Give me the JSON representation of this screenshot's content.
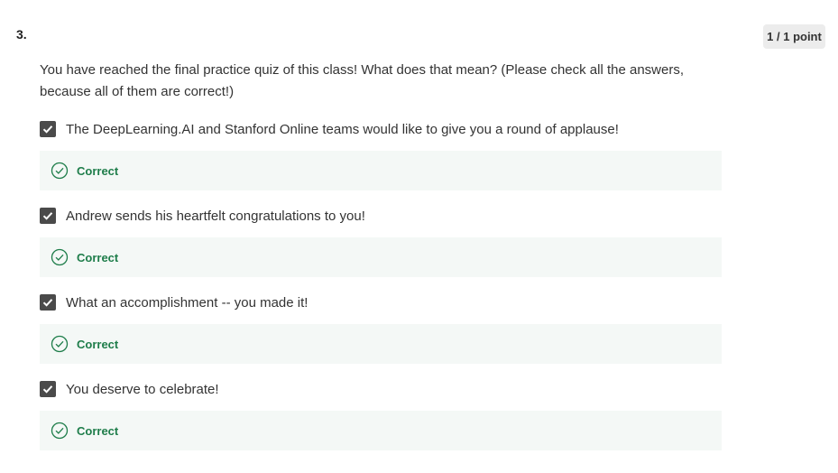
{
  "question": {
    "number": "3.",
    "score": "1 / 1 point",
    "prompt": "You have reached the final practice quiz of this class! What does that mean? (Please check all the answers, because all of them are correct!)",
    "options": [
      {
        "label": "The DeepLearning.AI and Stanford Online teams would like to give you a round of applause!",
        "checked": true,
        "feedback": "Correct"
      },
      {
        "label": "Andrew sends his heartfelt congratulations to you!",
        "checked": true,
        "feedback": "Correct"
      },
      {
        "label": "What an accomplishment -- you made it!",
        "checked": true,
        "feedback": "Correct"
      },
      {
        "label": "You deserve to celebrate!",
        "checked": true,
        "feedback": "Correct"
      }
    ]
  },
  "colors": {
    "checkbox": "#4a4a4a",
    "correct_text": "#1e7d4a",
    "feedback_bg": "#f4f8f6",
    "badge_bg": "#ececec"
  },
  "icons": {
    "checkbox": "checkmark-icon",
    "feedback": "check-circle-icon"
  }
}
